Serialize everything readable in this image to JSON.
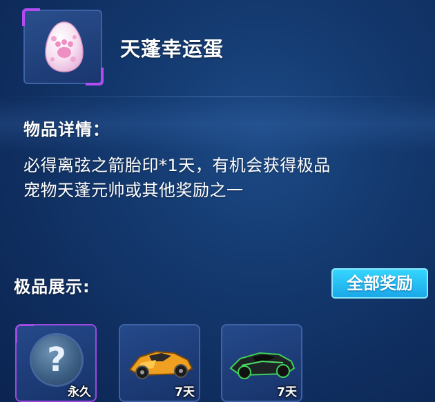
{
  "item": {
    "name": "天蓬幸运蛋",
    "icon": "pink-paw-egg-icon"
  },
  "details": {
    "heading": "物品详情：",
    "description_line1": "必得离弦之箭胎印*1天，有机会获得极品",
    "description_line2": "宠物天蓬元帅或其他奖励之一"
  },
  "showcase": {
    "heading": "极品展示:",
    "all_rewards_button": "全部奖励",
    "rewards": [
      {
        "icon": "mystery-question-icon",
        "duration": "永久"
      },
      {
        "icon": "orange-kart-icon",
        "duration": "7天"
      },
      {
        "icon": "black-green-kart-icon",
        "duration": "7天"
      }
    ]
  },
  "colors": {
    "background": "#143a70",
    "rare_frame": "#b04cf0",
    "button": "#1aa8e8"
  }
}
